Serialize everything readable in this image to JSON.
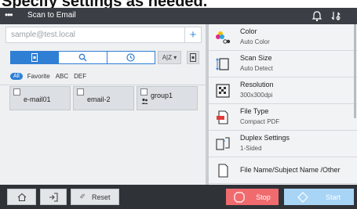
{
  "instruction": "Specify settings as needed.",
  "titlebar": {
    "menu_icon": "ellipsis-icon",
    "title": "Scan to Email"
  },
  "left": {
    "address_placeholder": "sample@test.local",
    "add_label": "+",
    "sort_label": "A|Z",
    "filters": {
      "all": "All",
      "favorite": "Favorite",
      "abc": "ABC",
      "def": "DEF"
    },
    "destinations": [
      {
        "label": "e-mail01"
      },
      {
        "label": "email-2"
      },
      {
        "label": "group1"
      }
    ]
  },
  "settings": [
    {
      "name": "Color",
      "value": "Auto Color"
    },
    {
      "name": "Scan Size",
      "value": "Auto Detect"
    },
    {
      "name": "Resolution",
      "value": "300x300dpi"
    },
    {
      "name": "File Type",
      "value": "Compact PDF"
    },
    {
      "name": "Duplex Settings",
      "value": "1-Sided"
    },
    {
      "name": "File Name/Subject Name /Other",
      "value": ""
    }
  ],
  "bottom": {
    "reset": "Reset",
    "stop": "Stop",
    "start": "Start"
  },
  "colors": {
    "titlebar": "#3b3f45",
    "accent": "#2f7fd4",
    "stop": "#f06b6e",
    "start": "#a8d4f5",
    "bottom_bar": "#2f3338"
  }
}
